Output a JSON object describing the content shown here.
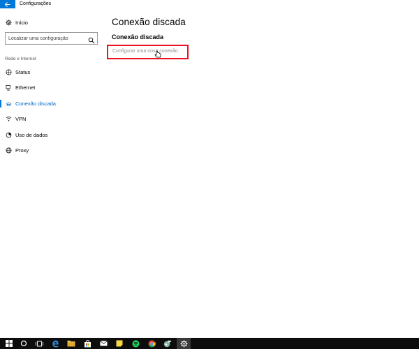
{
  "window": {
    "title": "Configurações",
    "back_icon": "back-arrow-icon"
  },
  "sidebar": {
    "home_label": "Início",
    "search_placeholder": "Localizar uma configuração",
    "section_label": "Rede e Internet",
    "items": [
      {
        "label": "Status",
        "icon": "globe-status-icon",
        "active": false
      },
      {
        "label": "Ethernet",
        "icon": "ethernet-icon",
        "active": false
      },
      {
        "label": "Conexão discada",
        "icon": "dialup-icon",
        "active": true
      },
      {
        "label": "VPN",
        "icon": "vpn-icon",
        "active": false
      },
      {
        "label": "Uso de dados",
        "icon": "data-usage-icon",
        "active": false
      },
      {
        "label": "Proxy",
        "icon": "globe-icon",
        "active": false
      }
    ]
  },
  "main": {
    "title": "Conexão discada",
    "subtitle": "Conexão discada",
    "link_label": "Configurar uma nova conexão"
  },
  "taskbar": {
    "items": [
      "start",
      "cortana",
      "task-view",
      "edge",
      "file-explorer",
      "store",
      "mail",
      "sticky-notes",
      "spotify",
      "chrome",
      "app",
      "settings"
    ]
  },
  "colors": {
    "accent": "#0078d7",
    "highlight_border": "#e8141f",
    "taskbar": "#0d0d0d"
  }
}
